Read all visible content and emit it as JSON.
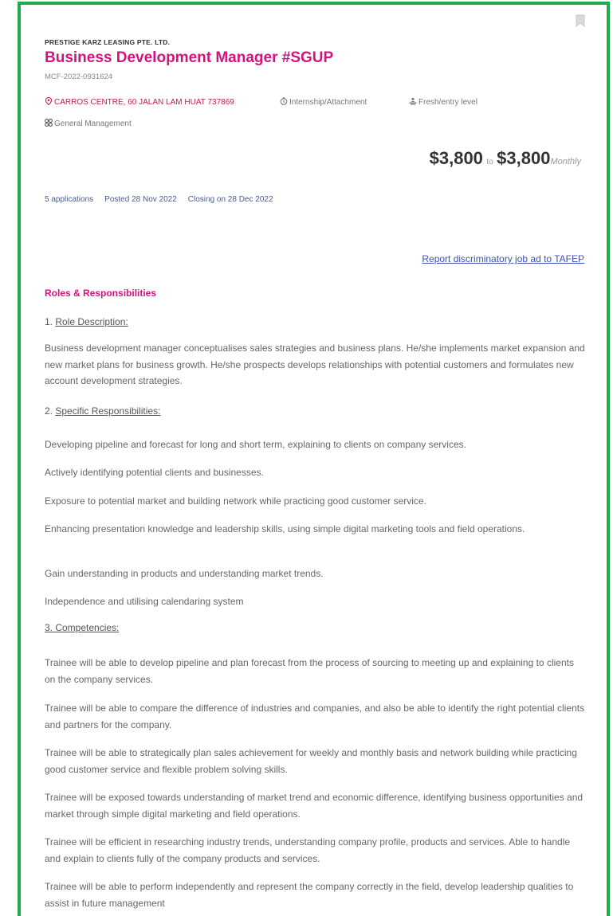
{
  "job": {
    "company": "PRESTIGE KARZ LEASING PTE. LTD.",
    "title": "Business Development Manager #SGUP",
    "mcf_id": "MCF-2022-0931624",
    "address": "CARROS CENTRE, 60 JALAN LAM HUAT 737869",
    "employment_type": "Internship/Attachment",
    "seniority": "Fresh/entry level",
    "category": "General Management",
    "salary_min": "$3,800",
    "salary_to": "to",
    "salary_max": "$3,800",
    "salary_period": "Monthly",
    "applications": "5 applications",
    "posted": "Posted 28 Nov 2022",
    "closing": "Closing on 28 Dec 2022",
    "report_link": "Report discriminatory job ad to TAFEP"
  },
  "description": {
    "section_title": "Roles & Responsibilities",
    "role_num": "1.",
    "role_heading": "Role Description:",
    "role_text": "Business development manager conceptualises sales strategies and business plans. He/she implements market expansion and new market plans for business growth. He/she prospects develops relationships with potential customers and formulates new account development strategies.",
    "resp_num": "2.",
    "resp_heading": "Specific Responsibilities:",
    "responsibilities": [
      "Developing pipeline and forecast for long and short term, explaining to clients on company services.",
      "Actively identifying potential clients and businesses.",
      "Exposure to potential market and building network while practicing good customer service.",
      "Enhancing presentation knowledge and leadership skills, using simple digital marketing tools and field operations.",
      "Gain understanding in products and understanding market trends.",
      "Independence and utilising calendaring system"
    ],
    "comp_heading": "3. Competencies:",
    "competencies": [
      "Trainee will be able to develop pipeline and plan forecast from the process of sourcing to meeting up and explaining to clients on the company services.",
      "Trainee will be able to compare the difference of industries and companies, and also be able to identify the right potential clients and partners for the company.",
      "Trainee will be able to strategically plan sales achievement for weekly and monthly basis and network building while practicing good customer service and flexible problem solving skills.",
      "Trainee will be exposed towards understanding of market trend and economic difference, identifying business opportunities and market through simple digital marketing and field operations.",
      "Trainee will be efficient in researching industry trends, understanding company profile, products and services. Able to handle and explain to clients fully of the company products and services.",
      "Trainee will be able to perform independently and represent the company correctly in the field, develop leadership qualities to assist in future management"
    ]
  },
  "colors": {
    "frame": "#1fad4b",
    "accent": "#d3147f",
    "link": "#3f51b5"
  },
  "icons": [
    "bookmark-icon",
    "location-pin-icon",
    "clock-icon",
    "person-level-icon",
    "category-icon"
  ]
}
